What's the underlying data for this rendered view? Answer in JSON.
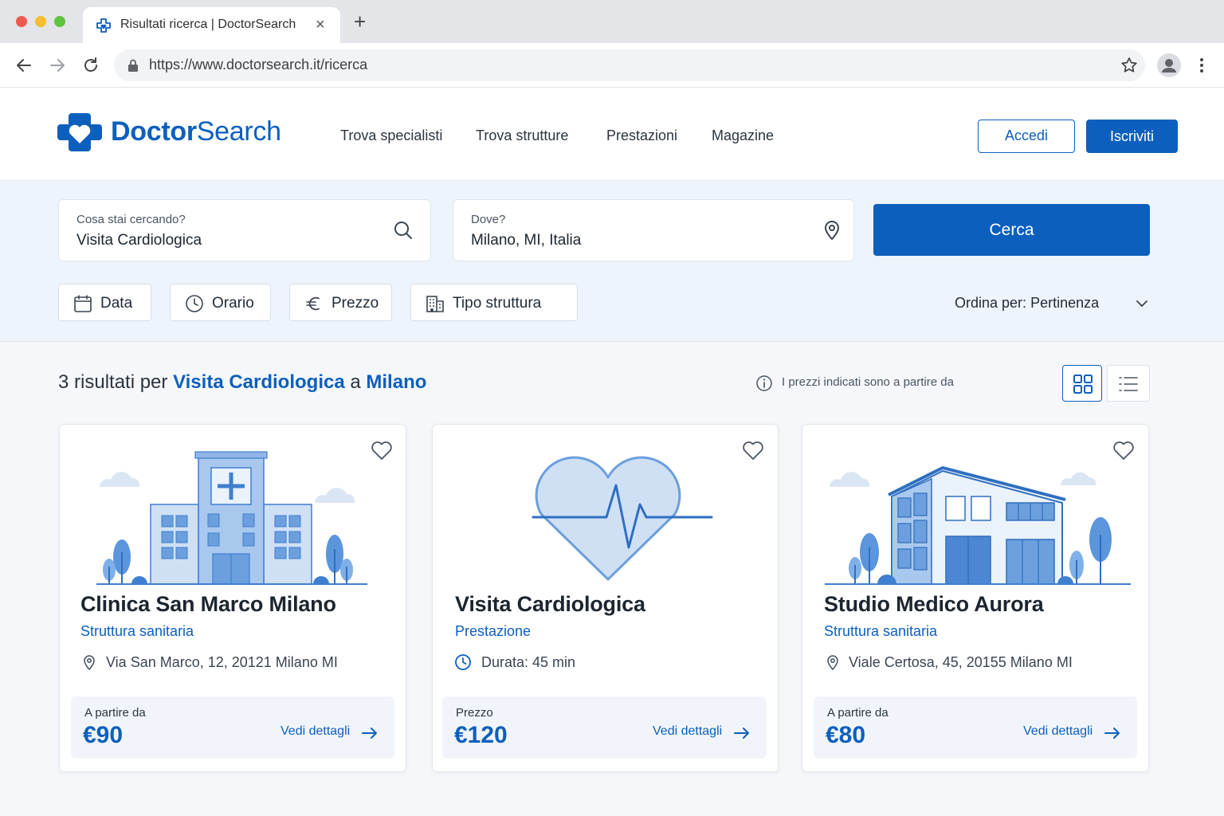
{
  "browser": {
    "tab_title": "Risultati ricerca | DoctorSearch",
    "tab_close": "×",
    "new_tab": "+",
    "url": "https://www.doctorsearch.it/ricerca"
  },
  "header": {
    "brand_part1": "Doctor",
    "brand_part2": "Search",
    "nav": [
      "Trova specialisti",
      "Trova strutture",
      "Prestazioni",
      "Magazine"
    ],
    "login_label": "Accedi",
    "signup_label": "Iscriviti"
  },
  "search": {
    "what_label": "Cosa stai cercando?",
    "what_value": "Visita Cardiologica",
    "where_label": "Dove?",
    "where_value": "Milano, MI, Italia",
    "button_label": "Cerca",
    "filters": [
      "Data",
      "Orario",
      "Prezzo",
      "Tipo struttura"
    ],
    "sort_label": "Ordina per:",
    "sort_value": "Pertinenza"
  },
  "results": {
    "count_text": "3 risultati per",
    "query": "Visita Cardiologica",
    "connector": "a",
    "location": "Milano",
    "price_note": "I prezzi indicati sono a partire da",
    "cards": [
      {
        "title": "Clinica San Marco Milano",
        "subtitle": "Struttura sanitaria",
        "meta": "Via San Marco, 12, 20121 Milano MI",
        "meta_icon": "map-pin-icon",
        "price_label": "A partire da",
        "price": "€90",
        "link": "Vedi dettagli"
      },
      {
        "title": "Visita Cardiologica",
        "subtitle": "Prestazione",
        "meta": "Durata: 45 min",
        "meta_icon": "clock-icon",
        "price_label": "Prezzo",
        "price": "€120",
        "link": "Vedi dettagli"
      },
      {
        "title": "Studio Medico Aurora",
        "subtitle": "Struttura sanitaria",
        "meta": "Viale Certosa, 45, 20155 Milano MI",
        "meta_icon": "map-pin-icon",
        "price_label": "A partire da",
        "price": "€80",
        "link": "Vedi dettagli"
      }
    ]
  },
  "colors": {
    "brand": "#0d5fbd",
    "band": "#edf4fc",
    "page": "#f5f7fa"
  }
}
